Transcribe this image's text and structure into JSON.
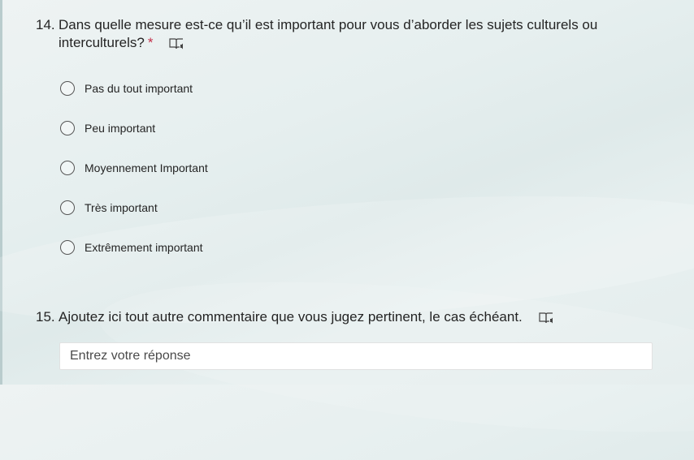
{
  "q14": {
    "number": "14.",
    "text": "Dans quelle mesure est-ce qu’il est important pour vous d’aborder les sujets culturels ou interculturels?",
    "required_marker": "*",
    "options": [
      "Pas du tout important",
      "Peu important",
      "Moyennement Important",
      "Très important",
      "Extrêmement important"
    ]
  },
  "q15": {
    "number": "15.",
    "text": "Ajoutez ici tout autre commentaire que vous jugez pertinent, le cas échéant.",
    "placeholder": "Entrez votre réponse"
  },
  "icons": {
    "immersive_reader": "immersive-reader-icon"
  },
  "colors": {
    "required": "#c4314b",
    "radio_border": "#555555"
  }
}
